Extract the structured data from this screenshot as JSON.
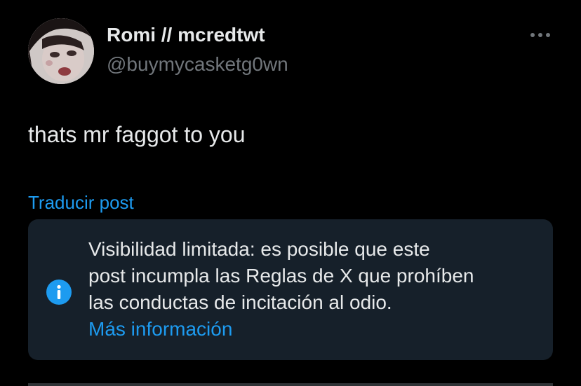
{
  "tweet": {
    "author": {
      "display_name": "Romi // mcredtwt",
      "handle": "@buymycasketg0wn",
      "avatar_icon": "profile-photo"
    },
    "more_icon": "ellipsis-icon",
    "text": "thats mr faggot to you",
    "translate_label": "Traducir post"
  },
  "notice": {
    "icon": "info-icon",
    "lines": [
      "Visibilidad limitada: es posible que este",
      "post incumpla las Reglas de X que prohíben",
      "las conductas de incitación al odio."
    ],
    "link_label": "Más información"
  },
  "colors": {
    "background": "#000000",
    "text": "#e7e9ea",
    "secondary_text": "#71767b",
    "accent": "#1d9bf0",
    "notice_background": "#16202a"
  }
}
